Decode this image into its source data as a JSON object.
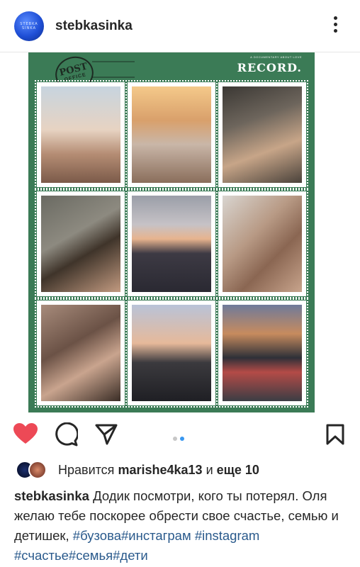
{
  "account": {
    "username": "stebkasinka",
    "avatar_text": "STEBKA SINKA"
  },
  "post_image": {
    "stamp_line1": "POST",
    "stamp_line2": "OFFICE",
    "record_subtitle": "A DOCUMENTARY ABOUT LOVE",
    "record_title": "RECORD."
  },
  "actions": {
    "like_icon": "heart-icon-filled",
    "comment_icon": "comment-icon",
    "share_icon": "send-icon",
    "save_icon": "bookmark-icon",
    "carousel_active_index": 1,
    "carousel_count": 2,
    "like_color": "#ed4956"
  },
  "likes": {
    "prefix": "Нравится",
    "user": "marishe4ka13",
    "and": "и",
    "more": "еще 10"
  },
  "caption": {
    "username": "stebkasinka",
    "text": "Додик посмотри, кого  ты потерял. Оля желаю тебе поскорее обрести свое счастье, семью и детишек,",
    "hashtags_line1": "#бузова#инстаграм",
    "hashtags_line2": "#instagram #счастье#семья#дети"
  },
  "colors": {
    "post_background": "#3b7b56",
    "hashtag": "#2a5a8c",
    "carousel_active": "#3897f0",
    "carousel_inactive": "#c7c7c7"
  }
}
